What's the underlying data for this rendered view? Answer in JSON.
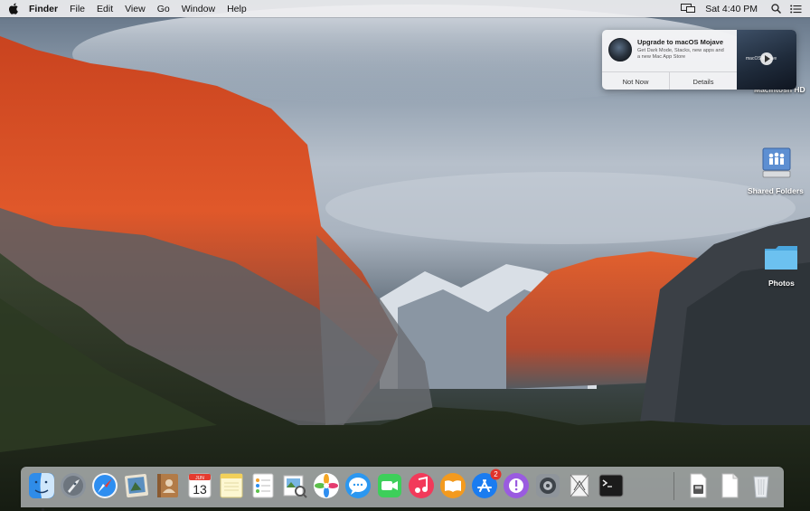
{
  "menubar": {
    "items": [
      "Finder",
      "File",
      "Edit",
      "View",
      "Go",
      "Window",
      "Help"
    ],
    "clock": "Sat 4:40 PM",
    "icons": [
      "apple-icon",
      "airplay-display-icon",
      "spotlight-search-icon",
      "notification-center-icon"
    ]
  },
  "notification": {
    "title": "Upgrade to macOS Mojave",
    "body": "Get Dark Mode, Stacks, new apps and a new Mac App Store",
    "thumb_text": "macOS Mojave",
    "buttons": [
      "Not Now",
      "Details"
    ]
  },
  "desktop_icons": [
    {
      "name": "macintosh-hd",
      "label": "Macintosh HD"
    },
    {
      "name": "shared-folders",
      "label": "Shared Folders"
    },
    {
      "name": "photos-folder",
      "label": "Photos"
    }
  ],
  "dock": {
    "apps": [
      {
        "name": "finder-icon",
        "label": "Finder",
        "running": true
      },
      {
        "name": "launchpad-icon",
        "label": "Launchpad"
      },
      {
        "name": "safari-icon",
        "label": "Safari"
      },
      {
        "name": "mail-photo-icon",
        "label": "Mail"
      },
      {
        "name": "contacts-icon",
        "label": "Contacts"
      },
      {
        "name": "calendar-icon",
        "label": "Calendar",
        "month": "JUN",
        "day": "13"
      },
      {
        "name": "notes-icon",
        "label": "Notes"
      },
      {
        "name": "reminders-icon",
        "label": "Reminders"
      },
      {
        "name": "preview-icon",
        "label": "Preview"
      },
      {
        "name": "photos-icon",
        "label": "Photos"
      },
      {
        "name": "messages-icon",
        "label": "Messages"
      },
      {
        "name": "facetime-icon",
        "label": "FaceTime"
      },
      {
        "name": "itunes-icon",
        "label": "iTunes"
      },
      {
        "name": "ibooks-icon",
        "label": "iBooks"
      },
      {
        "name": "app-store-icon",
        "label": "App Store",
        "badge": "2"
      },
      {
        "name": "feedback-assistant-icon",
        "label": "Feedback Assistant"
      },
      {
        "name": "system-preferences-icon",
        "label": "System Preferences"
      },
      {
        "name": "directory-utility-icon",
        "label": "Directory Utility"
      },
      {
        "name": "terminal-icon",
        "label": "Terminal"
      }
    ],
    "others": [
      {
        "name": "installer-disk-icon",
        "label": "Disk Image"
      },
      {
        "name": "documents-icon",
        "label": "Documents"
      },
      {
        "name": "trash-icon",
        "label": "Trash"
      }
    ]
  },
  "colors": {
    "menubar_bg": "#eeeef0",
    "accent_blue": "#1a7cf0",
    "badge_red": "#e0332b",
    "folder_blue": "#63b8ea"
  }
}
